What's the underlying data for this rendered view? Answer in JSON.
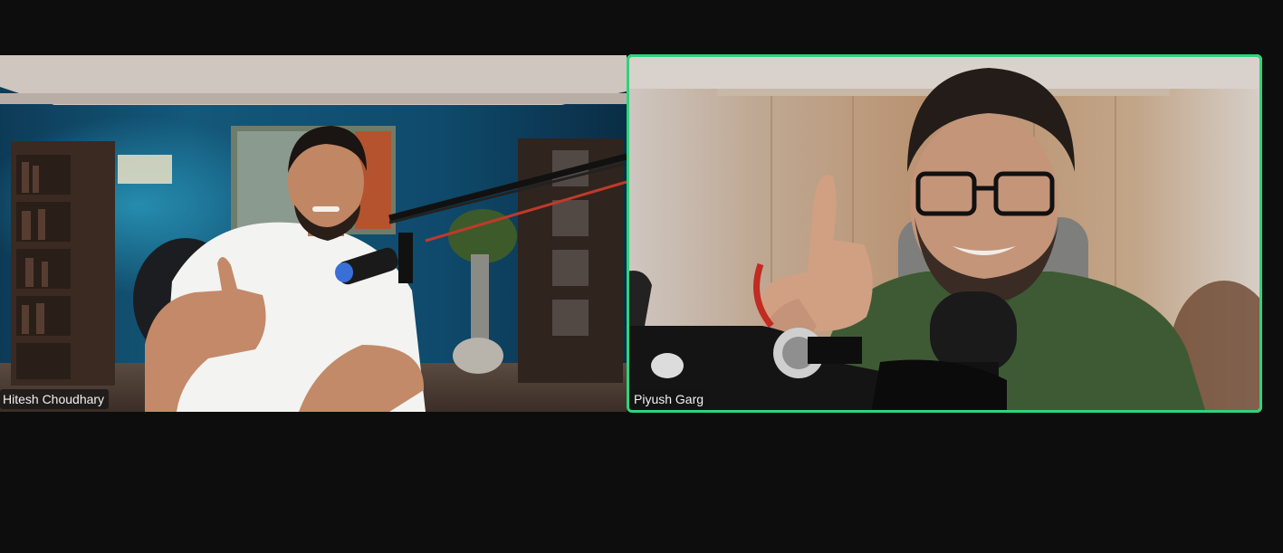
{
  "meeting": {
    "participants": [
      {
        "name": "Hitesh Choudhary",
        "speaking": false
      },
      {
        "name": "Piyush Garg",
        "speaking": true
      }
    ]
  },
  "colors": {
    "background": "#0d0d0d",
    "active_speaker_border": "#2ed47a",
    "name_tag_bg": "#141414"
  }
}
